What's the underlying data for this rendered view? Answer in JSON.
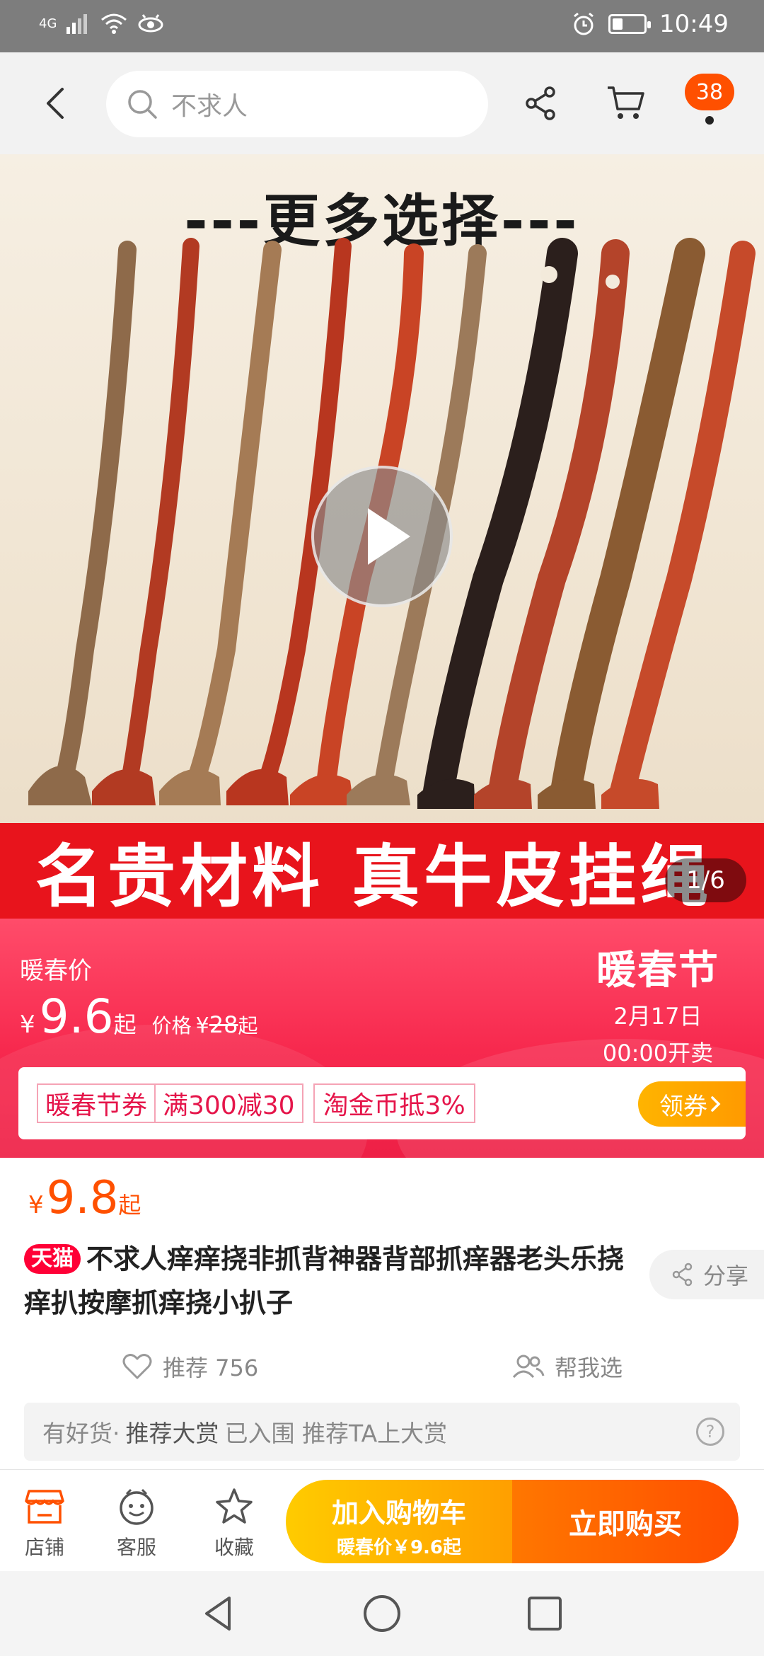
{
  "status_bar": {
    "network": "4G",
    "time": "10:49",
    "battery_level": 0.3
  },
  "header": {
    "search_placeholder": "不求人",
    "cart_badge": "38"
  },
  "hero": {
    "title": "---更多选择---",
    "banner": "名贵材料  真牛皮挂绳",
    "page_indicator": "1/6"
  },
  "promo": {
    "label": "暖春价",
    "currency": "¥",
    "price": "9.6",
    "price_suffix": "起",
    "orig_label": "价格",
    "orig_price": "28",
    "orig_suffix": "起",
    "festival_name": "暖春节",
    "festival_date": "2月17日",
    "festival_time": "00:00开卖"
  },
  "coupons": {
    "tag1_left": "暖春节券",
    "tag1_right": "满300减30",
    "tag2": "淘金币抵3%",
    "get_label": "领券"
  },
  "product": {
    "currency": "¥",
    "price": "9.8",
    "price_suffix": "起",
    "tmall_badge": "天猫",
    "title": "不求人痒痒挠非抓背神器背部抓痒器老头乐挠痒扒按摩抓痒挠小扒子",
    "share_label": "分享",
    "recommend_label": "推荐 756",
    "help_choose_label": "帮我选",
    "hao_prefix": "有好货·",
    "hao_bold": "推荐大赏",
    "hao_suffix": "已入围 推荐TA上大赏"
  },
  "actions": {
    "shop_label": "店铺",
    "service_label": "客服",
    "favorite_label": "收藏",
    "add_cart_label": "加入购物车",
    "add_cart_sub": "暖春价￥9.6起",
    "buy_label": "立即购买"
  },
  "colors": {
    "accent_orange": "#ff5000",
    "promo_red": "#f7294e",
    "banner_red": "#e8141c"
  }
}
